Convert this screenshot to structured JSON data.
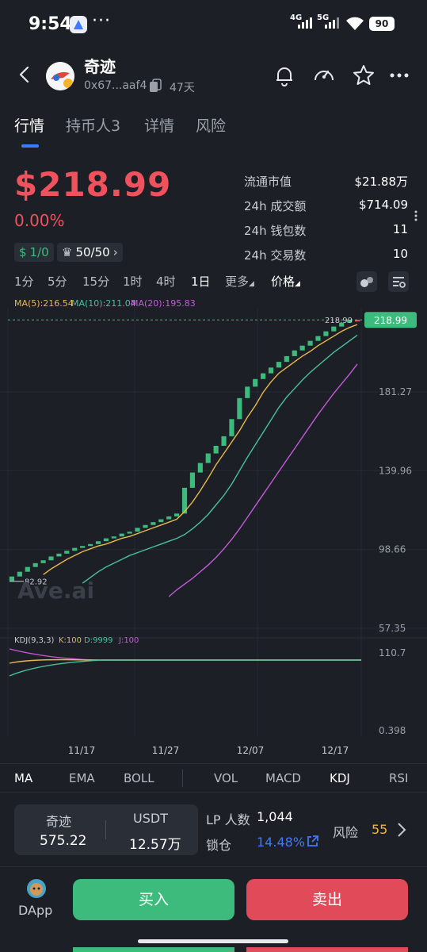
{
  "status_bar": {
    "time": "9:54",
    "network_1": "4G",
    "network_2": "5G",
    "battery": "90"
  },
  "header": {
    "token_name": "奇迹",
    "address": "0x67...aaf4",
    "age": "47天"
  },
  "tabs": [
    "行情",
    "持币人3",
    "详情",
    "风险"
  ],
  "price": {
    "value": "$218.99",
    "change": "0.00%",
    "badge_1": "1/0",
    "badge_2": "50/50"
  },
  "stats": [
    {
      "label": "流通市值",
      "value": "$21.88万"
    },
    {
      "label": "24h 成交额",
      "value": "$714.09"
    },
    {
      "label": "24h 钱包数",
      "value": "11"
    },
    {
      "label": "24h 交易数",
      "value": "10"
    }
  ],
  "timeframes": [
    "1分",
    "5分",
    "15分",
    "1时",
    "4时",
    "1日",
    "更多",
    "价格"
  ],
  "ma_legend": {
    "ma5": "MA(5):216.54",
    "ma10": "MA(10):211.04",
    "ma20": "MA(20):195.83"
  },
  "kdj_legend": {
    "title": "KDJ(9,3,3)",
    "k": "K:100",
    "d": "D:9999",
    "j": "J:100"
  },
  "watermark": "Ave.ai",
  "chart_data": {
    "type": "candlestick",
    "x_ticks": [
      "11/17",
      "11/27",
      "12/07",
      "12/17"
    ],
    "y_ticks": [
      181.27,
      139.96,
      98.66,
      57.35
    ],
    "y_top_label": "218.99",
    "ylim": [
      57.35,
      222.0
    ],
    "last_price": 218.99,
    "min_label": "82.92",
    "closes": [
      84.5,
      87.0,
      89.5,
      91.5,
      93.0,
      95.0,
      96.5,
      98.0,
      99.5,
      100.5,
      101.5,
      103.0,
      104.5,
      105.5,
      107.0,
      108.0,
      110.0,
      111.5,
      113.0,
      114.5,
      116.0,
      117.5,
      131.0,
      139.0,
      144.0,
      149.0,
      153.0,
      158.0,
      167.0,
      178.0,
      184.0,
      188.0,
      191.0,
      194.0,
      197.0,
      200.0,
      203.0,
      205.5,
      208.0,
      210.5,
      213.0,
      215.5,
      217.5,
      219.0,
      218.99
    ],
    "ma5": [
      null,
      null,
      null,
      null,
      85.5,
      88.5,
      91.0,
      93.5,
      95.5,
      97.5,
      99.0,
      100.5,
      101.5,
      103.0,
      104.5,
      105.5,
      107.0,
      108.5,
      110.0,
      111.5,
      113.0,
      114.5,
      118.5,
      123.5,
      129.5,
      136.0,
      143.0,
      149.0,
      155.0,
      161.0,
      168.0,
      174.0,
      181.0,
      186.5,
      191.0,
      194.0,
      197.0,
      200.0,
      202.5,
      205.5,
      208.0,
      210.5,
      213.0,
      215.0,
      216.54
    ],
    "ma10": [
      null,
      null,
      null,
      null,
      null,
      null,
      null,
      null,
      null,
      81.0,
      84.0,
      87.0,
      89.5,
      91.5,
      93.5,
      95.5,
      97.0,
      98.5,
      100.0,
      101.5,
      103.0,
      104.5,
      106.5,
      109.5,
      113.0,
      117.0,
      122.0,
      127.0,
      133.0,
      140.0,
      147.0,
      153.5,
      160.0,
      166.5,
      173.0,
      178.5,
      183.0,
      187.5,
      191.5,
      195.0,
      198.5,
      202.0,
      205.0,
      208.0,
      211.04
    ],
    "ma20": [
      null,
      null,
      null,
      null,
      null,
      null,
      null,
      null,
      null,
      null,
      null,
      null,
      null,
      null,
      null,
      null,
      null,
      null,
      null,
      null,
      74.0,
      77.5,
      80.5,
      83.5,
      87.0,
      90.5,
      94.5,
      99.0,
      104.0,
      109.5,
      115.5,
      121.5,
      127.5,
      133.5,
      139.5,
      145.5,
      151.5,
      157.5,
      163.5,
      169.5,
      175.0,
      180.5,
      185.5,
      190.5,
      195.83
    ]
  },
  "kdj_axis": {
    "top": "110.7",
    "bottom": "0.398"
  },
  "indicator_tabs": [
    "MA",
    "EMA",
    "BOLL",
    "VOL",
    "MACD",
    "KDJ",
    "RSI"
  ],
  "pool": {
    "token_label": "奇迹",
    "token_value": "575.22",
    "quote_label": "USDT",
    "quote_value": "12.57万"
  },
  "lp": {
    "holders_label": "LP 人数",
    "holders_value": "1,044",
    "lock_label": "锁仓",
    "lock_value": "14.48%",
    "risk_label": "风险",
    "risk_value": "55"
  },
  "actions": {
    "dapp": "DApp",
    "buy": "买入",
    "sell": "卖出"
  },
  "colors": {
    "up": "#3dbb7c",
    "down": "#f0525d",
    "ma5": "#e8b84a",
    "ma10": "#47c39a",
    "ma20": "#c55ad9",
    "accent": "#3e7bfa",
    "risk": "#f5b53c"
  }
}
